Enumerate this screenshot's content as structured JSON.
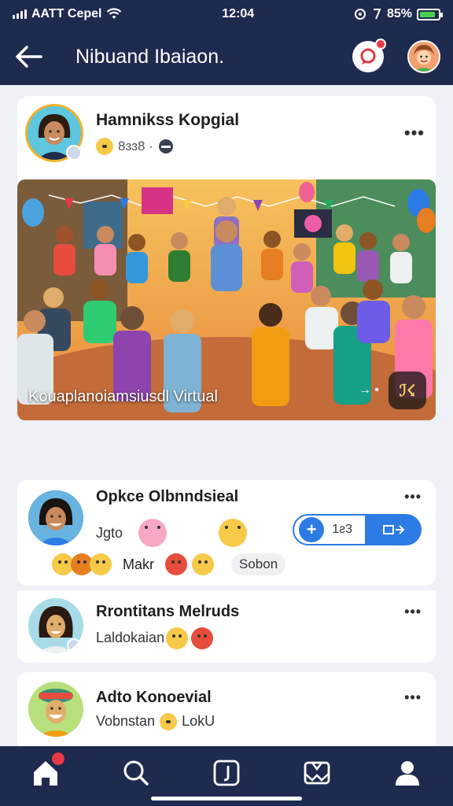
{
  "statusbar": {
    "carrier": "AATT Cepel",
    "time": "12:04",
    "battery": "85%",
    "battery_level": 0.85
  },
  "header": {
    "title": "Nibuand Ibaiaon.",
    "message_badge": true
  },
  "post": {
    "author": "Hamnikss Kopgial",
    "meta_text": "8ɜɜ8 ·",
    "caption": "Kouaplanoiamsiusdl Virtual",
    "controls": [
      "→ •",
      "ℐ☇"
    ]
  },
  "tabs": [
    {
      "name": "chat",
      "active": true
    },
    {
      "name": "comment"
    },
    {
      "name": "face"
    },
    {
      "name": "emoji"
    },
    {
      "name": "bell"
    },
    {
      "name": "more"
    }
  ],
  "comments": [
    {
      "name": "Opkce Olbnndsieal",
      "text": "Jgto",
      "count": "1ƨ3",
      "reactions_label": "Makr",
      "chip": "Sobon"
    },
    {
      "name": "Rrontitans Melruds",
      "text": "Laldokaian"
    },
    {
      "name": "Adto Konoevial",
      "text": "Vobnstan",
      "text_suffix": "LokU"
    }
  ],
  "colors": {
    "brand": "#1f2a4f",
    "accent": "#2d7be5",
    "badge": "#e63946"
  }
}
